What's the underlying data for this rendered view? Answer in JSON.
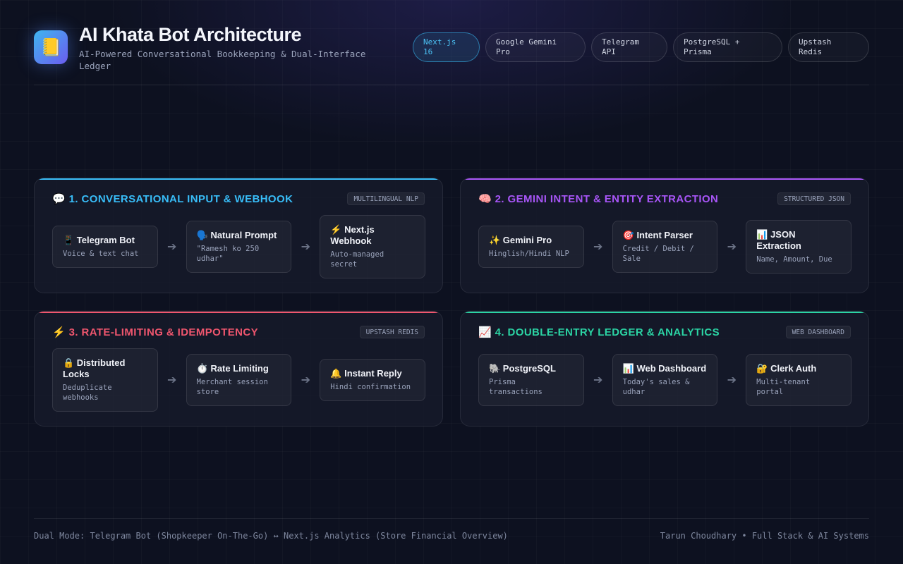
{
  "header": {
    "logo_icon": "📒",
    "title": "AI Khata Bot Architecture",
    "subtitle": "AI-Powered Conversational Bookkeeping & Dual-Interface Ledger",
    "tags": [
      "Next.js 16",
      "Google Gemini Pro",
      "Telegram API",
      "PostgreSQL + Prisma",
      "Upstash Redis"
    ]
  },
  "panels": [
    {
      "title": "💬 1. CONVERSATIONAL INPUT & WEBHOOK",
      "badge": "MULTILINGUAL NLP",
      "accent": "#38bdf8",
      "nodes": [
        {
          "title": "📱 Telegram Bot",
          "desc": "Voice & text chat"
        },
        {
          "title": "🗣️ Natural Prompt",
          "desc": "\"Ramesh ko 250 udhar\""
        },
        {
          "title": "⚡ Next.js Webhook",
          "desc": "Auto-managed secret"
        }
      ]
    },
    {
      "title": "🧠 2. GEMINI INTENT & ENTITY EXTRACTION",
      "badge": "STRUCTURED JSON",
      "accent": "#a855f7",
      "nodes": [
        {
          "title": "✨ Gemini Pro",
          "desc": "Hinglish/Hindi NLP"
        },
        {
          "title": "🎯 Intent Parser",
          "desc": "Credit / Debit / Sale"
        },
        {
          "title": "📊 JSON Extraction",
          "desc": "Name, Amount, Due"
        }
      ]
    },
    {
      "title": "⚡ 3. RATE-LIMITING & IDEMPOTENCY",
      "badge": "UPSTASH REDIS",
      "accent": "#f0566e",
      "nodes": [
        {
          "title": "🔒 Distributed Locks",
          "desc": "Deduplicate webhooks"
        },
        {
          "title": "⏱️ Rate Limiting",
          "desc": "Merchant session store"
        },
        {
          "title": "🔔 Instant Reply",
          "desc": "Hindi confirmation"
        }
      ]
    },
    {
      "title": "📈 4. DOUBLE-ENTRY LEDGER & ANALYTICS",
      "badge": "WEB DASHBOARD",
      "accent": "#2bd4a4",
      "nodes": [
        {
          "title": "🐘 PostgreSQL",
          "desc": "Prisma transactions"
        },
        {
          "title": "📊 Web Dashboard",
          "desc": "Today's sales & udhar"
        },
        {
          "title": "🔐 Clerk Auth",
          "desc": "Multi-tenant portal"
        }
      ]
    }
  ],
  "arrow_glyph": "➔",
  "footer": {
    "left": "Dual Mode: Telegram Bot (Shopkeeper On-The-Go) ↔ Next.js Analytics (Store Financial Overview)",
    "right": "Tarun Choudhary • Full Stack & AI Systems"
  }
}
